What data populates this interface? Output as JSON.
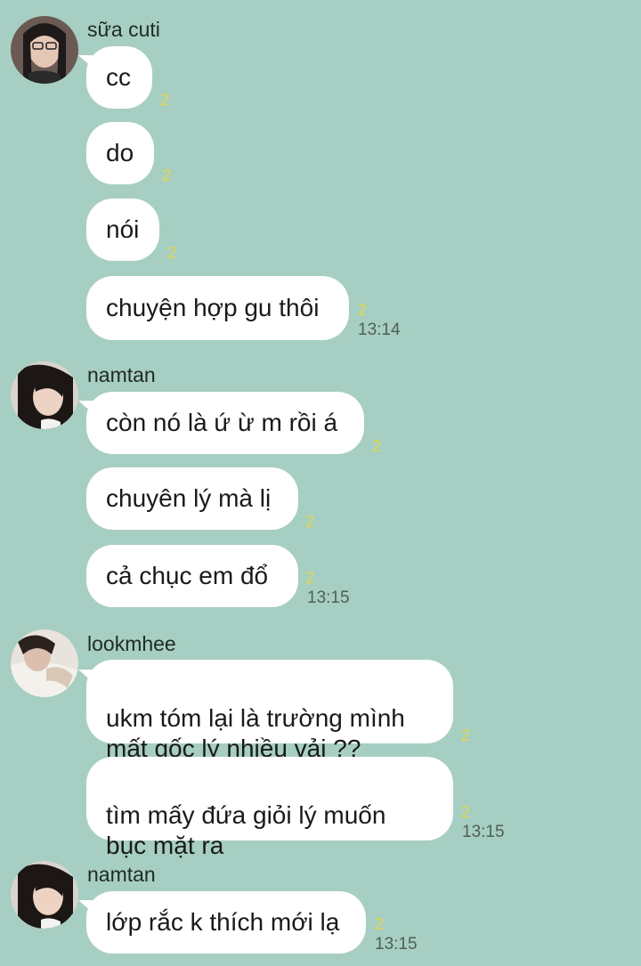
{
  "groups": [
    {
      "sender": "sữa cuti",
      "messages": [
        {
          "text": "cc",
          "read": "2"
        },
        {
          "text": "do",
          "read": "2"
        },
        {
          "text": "nói",
          "read": "2"
        },
        {
          "text": "chuyện hợp gu thôi",
          "read": "2",
          "time": "13:14"
        }
      ]
    },
    {
      "sender": "namtan",
      "messages": [
        {
          "text": "còn nó là ứ ừ m rồi á",
          "read": "2"
        },
        {
          "text": "chuyên lý mà lị",
          "read": "2"
        },
        {
          "text": "cả chục em đổ",
          "read": "2",
          "time": "13:15"
        }
      ]
    },
    {
      "sender": "lookmhee",
      "messages": [
        {
          "text": "ukm tóm lại là trường mình\nmất gốc lý nhiều vải ??",
          "read": "2"
        },
        {
          "text": "tìm mấy đứa giỏi lý muốn\nbục mặt ra",
          "read": "2",
          "time": "13:15"
        }
      ]
    },
    {
      "sender": "namtan",
      "messages": [
        {
          "text": "lớp rắc k thích mới lạ",
          "read": "2",
          "time": "13:15"
        }
      ]
    }
  ]
}
